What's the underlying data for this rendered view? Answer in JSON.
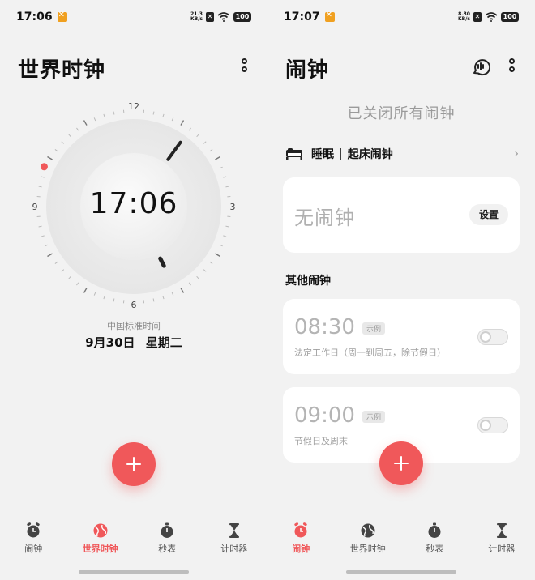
{
  "left": {
    "status": {
      "time": "17:06",
      "net_speed_value": "21.3",
      "net_speed_unit": "KB/s",
      "battery": "100"
    },
    "title": "世界时钟",
    "clock": {
      "digital_time": "17:06",
      "hour_value": 17,
      "minute_value": 6,
      "dial_labels": {
        "top": "12",
        "right": "3",
        "bottom": "6",
        "left": "9"
      },
      "accent_color": "#f0585a"
    },
    "timezone": "中国标准时间",
    "date": {
      "day": "9月30日",
      "weekday": "星期二"
    },
    "tabs": [
      {
        "label": "闹钟",
        "icon": "alarm-clock-icon",
        "active": false
      },
      {
        "label": "世界时钟",
        "icon": "globe-icon",
        "active": true
      },
      {
        "label": "秒表",
        "icon": "stopwatch-icon",
        "active": false
      },
      {
        "label": "计时器",
        "icon": "hourglass-icon",
        "active": false
      }
    ]
  },
  "right": {
    "status": {
      "time": "17:07",
      "net_speed_value": "8.80",
      "net_speed_unit": "KB/s",
      "battery": "100"
    },
    "title": "闹钟",
    "closed_message": "已关闭所有闹钟",
    "sleep": {
      "label": "睡眠",
      "separator": "|",
      "wake": "起床闹钟"
    },
    "no_alarm": {
      "text": "无闹钟",
      "button": "设置"
    },
    "section_title": "其他闹钟",
    "alarms": [
      {
        "time": "08:30",
        "tag": "示例",
        "desc": "法定工作日（周一到周五，除节假日）",
        "enabled": false
      },
      {
        "time": "09:00",
        "tag": "示例",
        "desc": "节假日及周末",
        "enabled": false
      }
    ],
    "tabs": [
      {
        "label": "闹钟",
        "icon": "alarm-clock-icon",
        "active": true
      },
      {
        "label": "世界时钟",
        "icon": "globe-icon",
        "active": false
      },
      {
        "label": "秒表",
        "icon": "stopwatch-icon",
        "active": false
      },
      {
        "label": "计时器",
        "icon": "hourglass-icon",
        "active": false
      }
    ]
  },
  "colors": {
    "accent": "#f0585a",
    "background": "#f2f2f2",
    "card": "#ffffff"
  }
}
